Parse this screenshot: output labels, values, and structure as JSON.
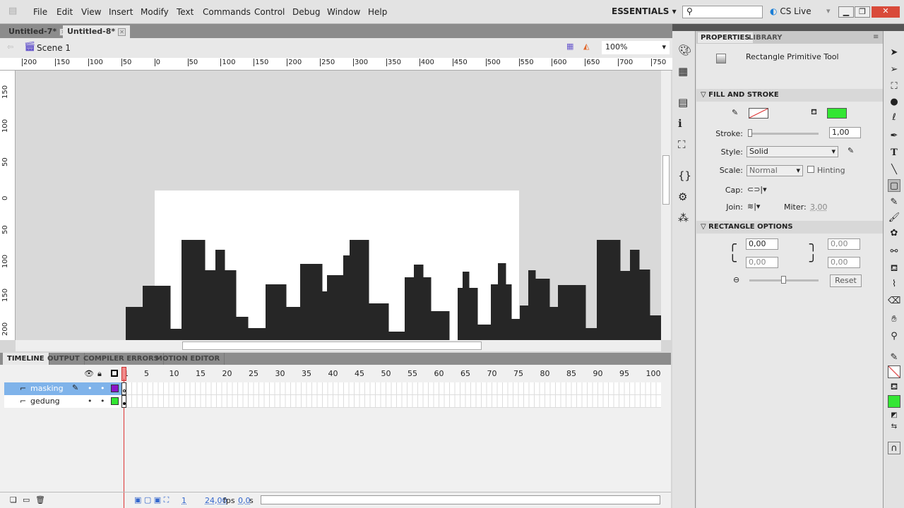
{
  "app": {
    "logo": "Fl",
    "menu": [
      "File",
      "Edit",
      "View",
      "Insert",
      "Modify",
      "Text",
      "Commands",
      "Control",
      "Debug",
      "Window",
      "Help"
    ],
    "workspace": "ESSENTIALS",
    "search_placeholder": "",
    "cs_live": "CS Live"
  },
  "documents": [
    {
      "label": "Untitled-7*",
      "active": false
    },
    {
      "label": "Untitled-8*",
      "active": true
    }
  ],
  "scene": {
    "label": "Scene 1",
    "zoom": "100%"
  },
  "ruler": {
    "h_ticks": [
      "200",
      "150",
      "100",
      "50",
      "0",
      "50",
      "100",
      "150",
      "200",
      "250",
      "300",
      "350",
      "400",
      "450",
      "500",
      "550",
      "600",
      "650",
      "700",
      "750"
    ],
    "v_ticks": [
      "150",
      "100",
      "50",
      "0",
      "50",
      "100",
      "150",
      "200"
    ]
  },
  "stage": {
    "background": "#ffffff",
    "shape_color": "#262626"
  },
  "timeline": {
    "tabs": [
      "TIMELINE",
      "OUTPUT",
      "COMPILER ERRORS",
      "MOTION EDITOR"
    ],
    "frames": [
      "1",
      "5",
      "10",
      "15",
      "20",
      "25",
      "30",
      "35",
      "40",
      "45",
      "50",
      "55",
      "60",
      "65",
      "70",
      "75",
      "80",
      "85",
      "90",
      "95",
      "100"
    ],
    "layers": [
      {
        "name": "masking",
        "color": "#8a14c8",
        "selected": true
      },
      {
        "name": "gedung",
        "color": "#33e633",
        "selected": false
      }
    ],
    "status": {
      "current_frame": "1",
      "fps": "24,00",
      "fps_unit": "fps",
      "time": "0,0",
      "time_unit": "s"
    }
  },
  "panel": {
    "tabs": [
      "PROPERTIES",
      "LIBRARY"
    ],
    "tool_name": "Rectangle Primitive Tool",
    "fill_stroke": {
      "title": "FILL AND STROKE",
      "stroke_color": "none",
      "fill_color": "#33e633",
      "stroke_label": "Stroke:",
      "stroke_value": "1,00",
      "style_label": "Style:",
      "style_value": "Solid",
      "scale_label": "Scale:",
      "scale_value": "Normal",
      "hinting_label": "Hinting",
      "cap_label": "Cap:",
      "join_label": "Join:",
      "miter_label": "Miter:",
      "miter_value": "3,00"
    },
    "rect_options": {
      "title": "RECTANGLE OPTIONS",
      "corners": [
        "0,00",
        "0,00",
        "0,00",
        "0,00"
      ],
      "reset_label": "Reset"
    }
  }
}
